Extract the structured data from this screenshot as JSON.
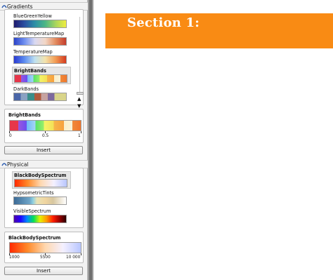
{
  "gradients_group": {
    "header": "Gradients",
    "items": [
      {
        "name": "BlueGreenYellow",
        "gradient": "linear-gradient(90deg,#1f1a6e,#2b4fa1,#2d8fa6,#4cb685,#a9d55c,#f0ee3f)"
      },
      {
        "name": "LightTemperatureMap",
        "gradient": "linear-gradient(90deg,#2b43c9,#6f8ff0,#d9d9f2,#f2d7c6,#e38c5f,#c43c2c)"
      },
      {
        "name": "TemperatureMap",
        "gradient": "linear-gradient(90deg,#2a3ad2,#5c8cf0,#bfe1f0,#f3e3ac,#f29b54,#d43a1f)"
      },
      {
        "name": "BrightBands",
        "gradient": "linear-gradient(90deg,#e7364a 0%,#e7364a 12%,#9a56e0 12%,#6a4ef0 24%,#6fb8f6 24%,#a6d6f5 36%,#56e06a 36%,#9aef6a 48%,#f4f468 48%,#f3e057 62%,#f6b64a 62%,#f7a13e 76%,#fbeec8 76%,#f9f3d9 88%,#f08a3a 88%,#f0762c 100%)",
        "selected": true
      },
      {
        "name": "DarkBands",
        "gradient": "linear-gradient(90deg,#4a66a8 0%,#4a66a8 13%,#8aa1c2 13%,#8aa1c2 26%,#3a8e8a 26%,#3a8e8a 39%,#b05a3c 39%,#b05a3c 52%,#c6a2a0 52%,#c6a2a0 65%,#7e6a9e 65%,#7e6a9e 78%,#d9d58a 78%,#d9d58a 100%)"
      }
    ],
    "preview": {
      "title": "BrightBands",
      "gradient": "linear-gradient(90deg,#e7364a 0%,#e7364a 12%,#9a56e0 12%,#6a4ef0 24%,#6fb8f6 24%,#a6d6f5 36%,#56e06a 36%,#9aef6a 48%,#f4f468 48%,#f3e057 62%,#f6b64a 62%,#f7a13e 76%,#fbeec8 76%,#f9f3d9 88%,#f08a3a 88%,#f0762c 100%)",
      "ticks": [
        "0",
        "0.5",
        "1"
      ]
    },
    "insert_label": "Insert"
  },
  "physical_group": {
    "header": "Physical",
    "items": [
      {
        "name": "BlackBodySpectrum",
        "gradient": "linear-gradient(90deg,#ff2a00,#ff8a2a,#ffd8b0,#f4f0ff,#b8c6ff)",
        "selected": true
      },
      {
        "name": "HypsometricTints",
        "gradient": "linear-gradient(90deg,#3d6b96 0%,#6fa5c8 30%,#8ccfe0 36%,#e9e3b6 44%,#f0d5a0 60%,#d8c7a0 75%,#ffffff 100%)"
      },
      {
        "name": "VisibleSpectrum",
        "gradient": "linear-gradient(90deg,#4b00a8,#2200ff,#0088ff,#00e05a,#e6f000,#ff9b00,#ff1d00,#9a0000,#2a0000)"
      }
    ],
    "preview": {
      "title": "BlackBodySpectrum",
      "gradient": "linear-gradient(90deg,#ff2a00,#ff8a2a,#ffd8b0,#f4f0ff,#b8c6ff)",
      "ticks": [
        "1000",
        "5500",
        "10 000"
      ]
    },
    "insert_label": "Insert"
  },
  "document": {
    "section_title": "Section 1:",
    "banner_color": "#f98b14"
  }
}
